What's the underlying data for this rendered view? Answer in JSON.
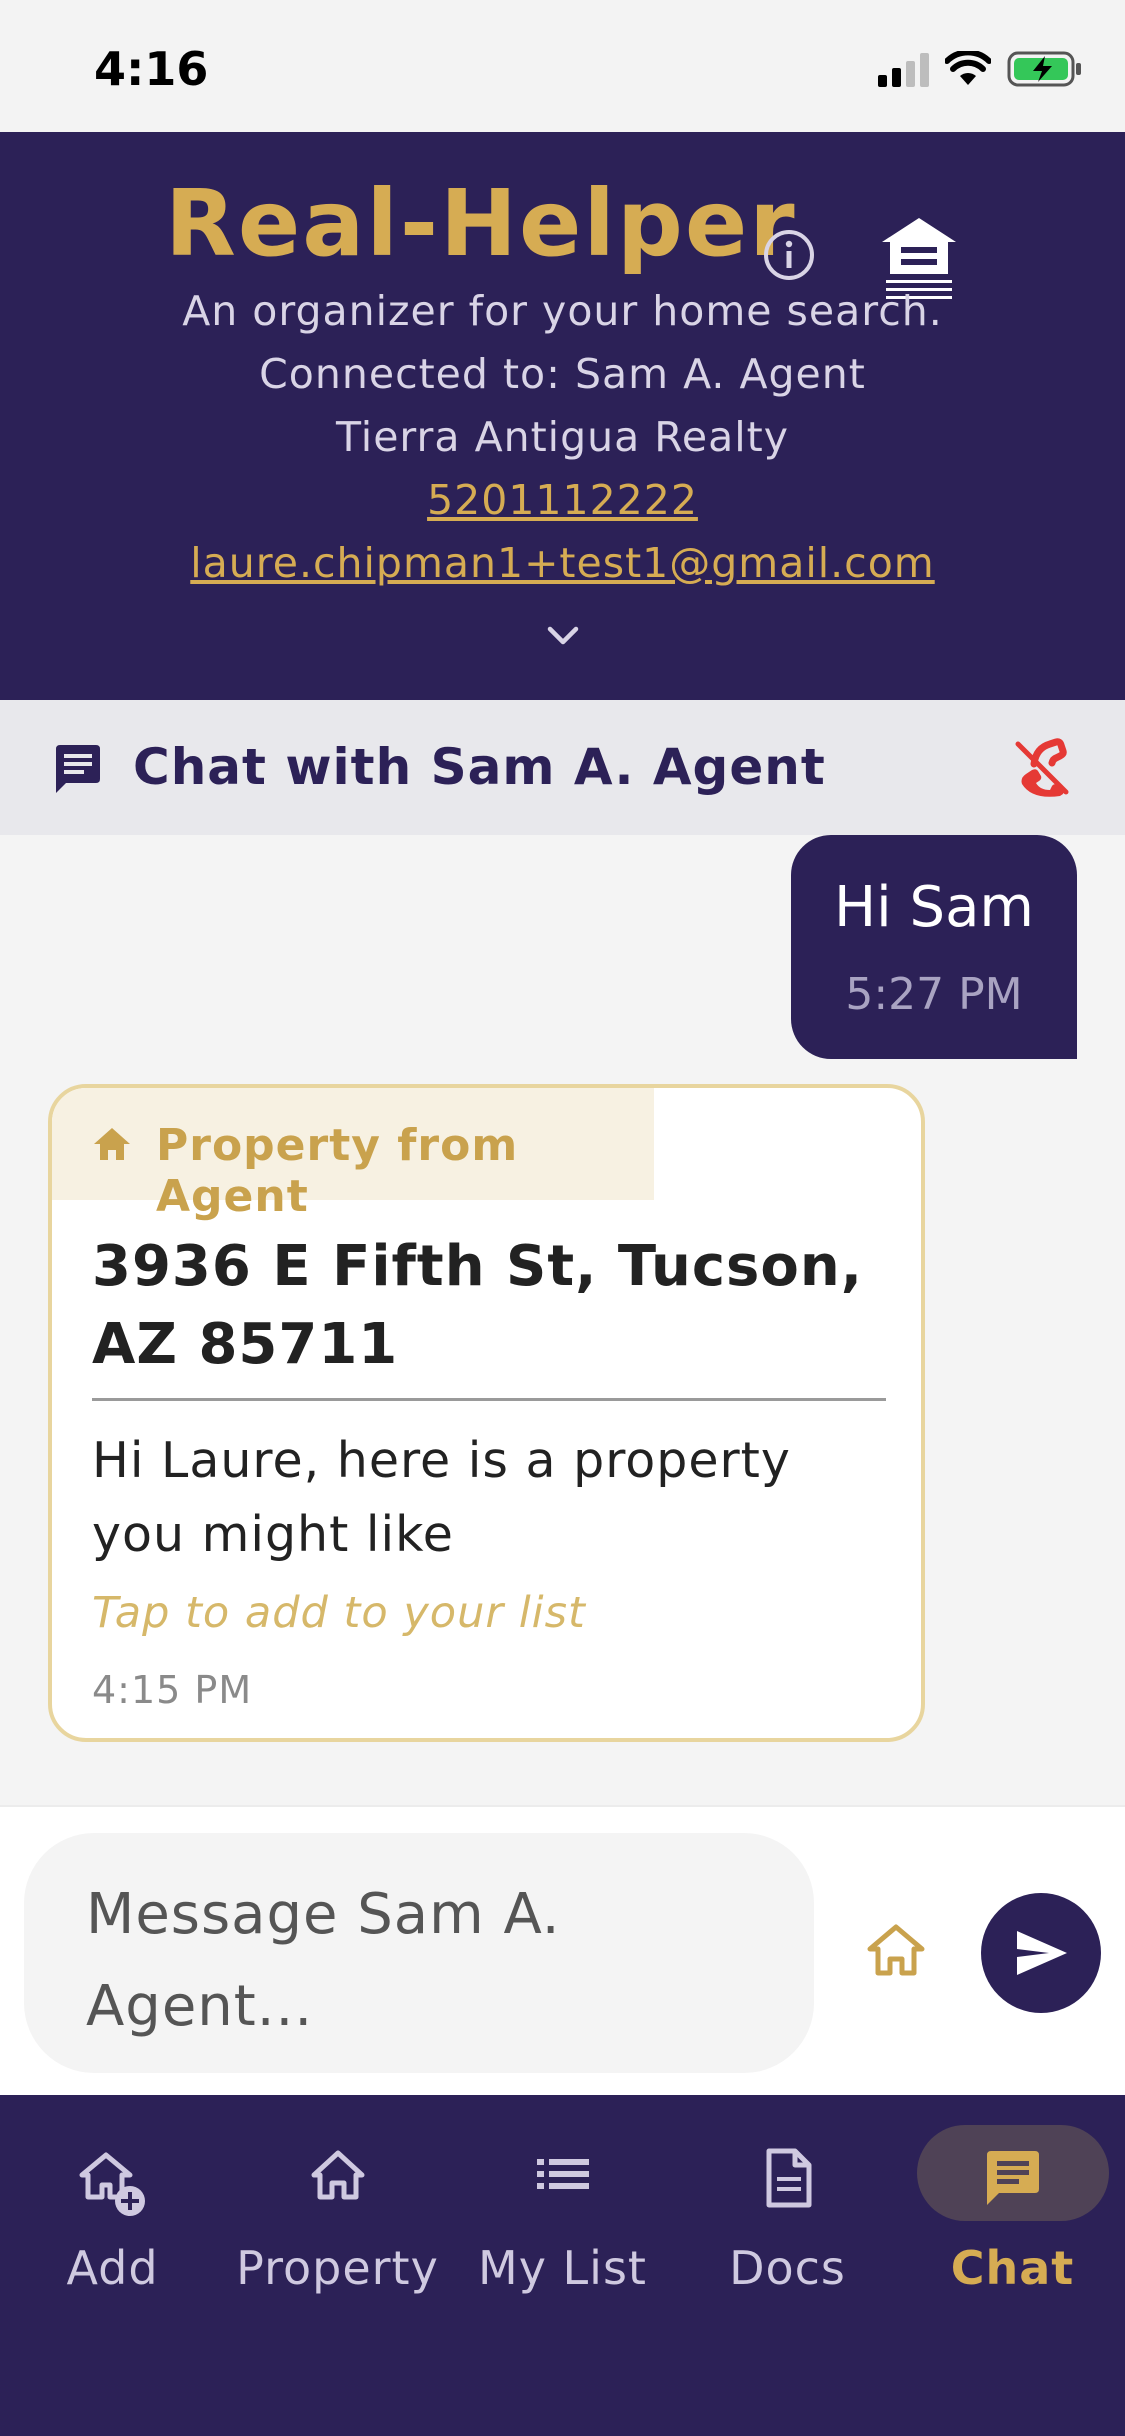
{
  "status_bar": {
    "time": "4:16"
  },
  "header": {
    "title": "Real-Helper",
    "tagline": "An organizer for your home search.",
    "connected": "Connected to: Sam A. Agent",
    "company": "Tierra Antigua Realty",
    "phone": "5201112222",
    "email": "laure.chipman1+test1@gmail.com"
  },
  "chat": {
    "title": "Chat with Sam A. Agent",
    "messages": [
      {
        "type": "outgoing",
        "text": "Hi Sam",
        "time": "5:27 PM"
      },
      {
        "type": "property",
        "tag": "Property from Agent",
        "address": "3936 E Fifth St, Tucson, AZ 85711",
        "text": "Hi Laure, here is a property you might like",
        "hint": "Tap to add to your list",
        "time": "4:15 PM"
      }
    ]
  },
  "composer": {
    "placeholder": "Message Sam A. Agent..."
  },
  "nav": {
    "items": [
      {
        "label": "Add",
        "icon": "house-plus-icon",
        "active": false
      },
      {
        "label": "Property",
        "icon": "house-icon",
        "active": false
      },
      {
        "label": "My List",
        "icon": "list-icon",
        "active": false
      },
      {
        "label": "Docs",
        "icon": "document-icon",
        "active": false
      },
      {
        "label": "Chat",
        "icon": "chat-icon",
        "active": true
      }
    ]
  },
  "colors": {
    "brand_purple": "#2c2157",
    "brand_gold": "#d6ac53",
    "hangup_red": "#e53935"
  }
}
